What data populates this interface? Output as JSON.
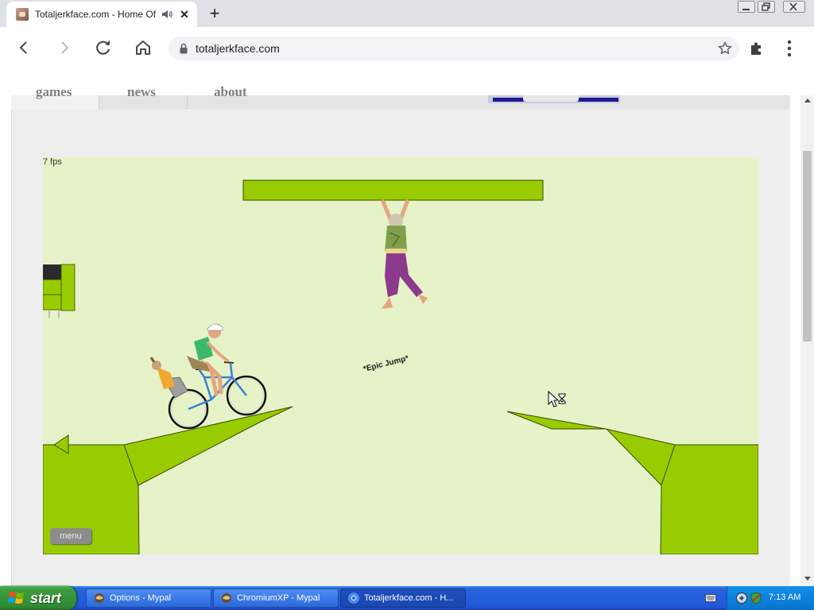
{
  "browser": {
    "tab": {
      "title": "Totaljerkface.com - Home Of Ha",
      "favicon": "totaljerkface-favicon-icon",
      "audio_icon": "speaker-icon",
      "close_icon": "close-icon"
    },
    "new_tab_icon": "plus-icon",
    "window_controls": [
      "minimize-icon",
      "restore-icon",
      "close-icon"
    ],
    "toolbar": {
      "back_icon": "back-arrow-icon",
      "forward_icon": "forward-arrow-icon",
      "reload_icon": "reload-icon",
      "home_icon": "home-icon"
    },
    "address_bar": {
      "lock_icon": "lock-icon",
      "url": "totaljerkface.com",
      "bookmark_icon": "star-icon",
      "extensions_icon": "puzzle-icon",
      "menu_icon": "kebab-menu-icon"
    }
  },
  "site": {
    "nav": [
      {
        "label": "games",
        "active": true
      },
      {
        "label": "news",
        "active": false
      },
      {
        "label": "about",
        "active": false
      }
    ]
  },
  "game": {
    "fps": "7 fps",
    "caption": "*Epic Jump*",
    "menu_label": "menu",
    "colors": {
      "background": "#e6f2c8",
      "ground": "#99cc00",
      "outline": "#3b4a00"
    }
  },
  "taskbar": {
    "start_label": "start",
    "tasks": [
      {
        "label": "Options - Mypal",
        "icon": "mypal-icon",
        "active": false
      },
      {
        "label": "ChromiumXP - Mypal",
        "icon": "mypal-icon",
        "active": false
      },
      {
        "label": "Totaljerkface.com - H...",
        "icon": "chromium-icon",
        "active": true
      }
    ],
    "tray": {
      "clock": "7:13 AM",
      "keyboard_icon": "keyboard-icon"
    }
  }
}
